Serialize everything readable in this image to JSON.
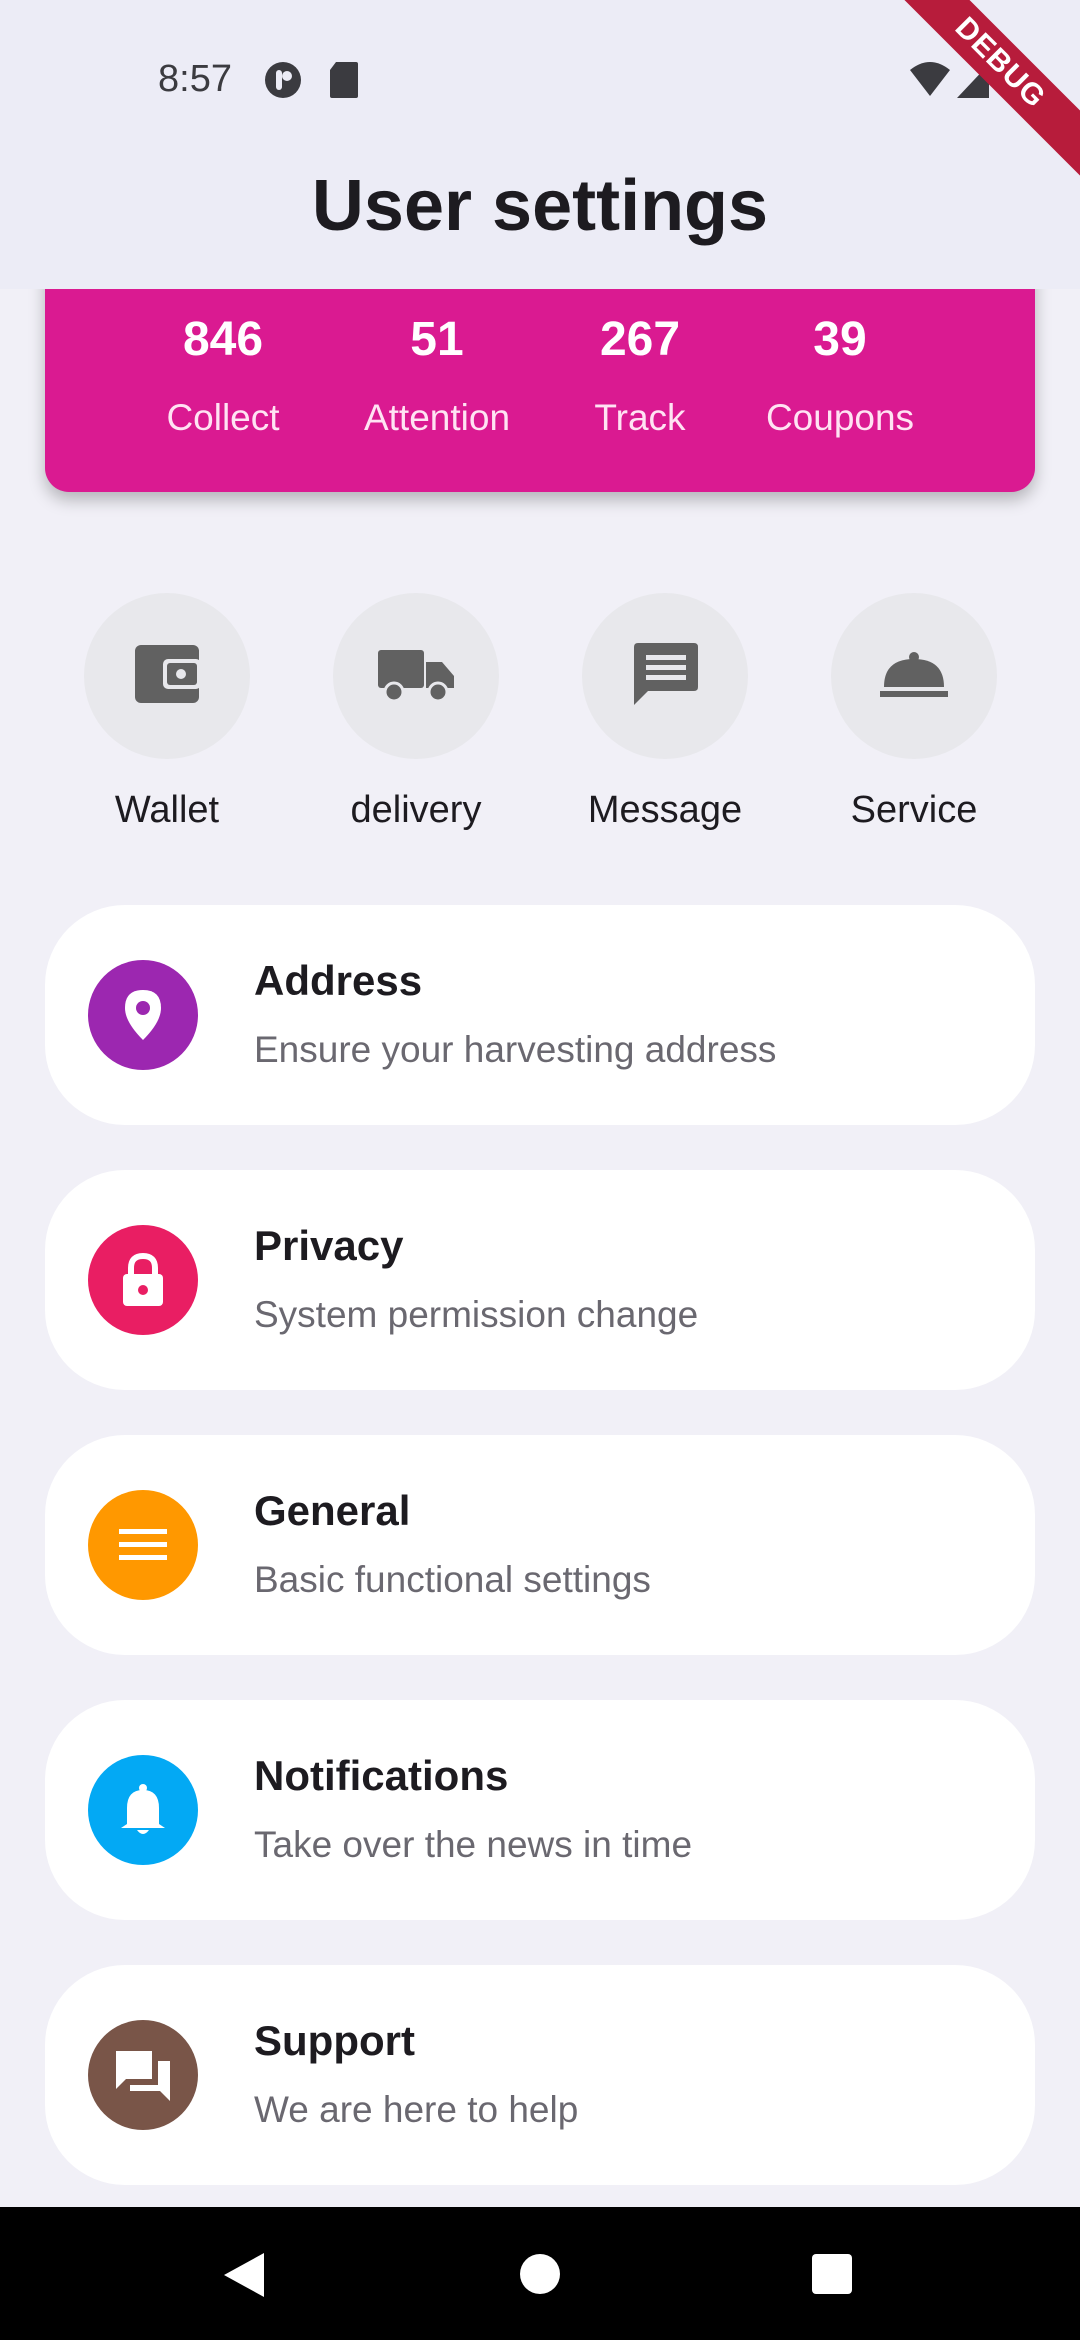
{
  "status_bar": {
    "time": "8:57"
  },
  "debug_banner": "DEBUG",
  "app_bar": {
    "title": "User settings"
  },
  "stats": [
    {
      "value": "846",
      "label": "Collect"
    },
    {
      "value": "51",
      "label": "Attention"
    },
    {
      "value": "267",
      "label": "Track"
    },
    {
      "value": "39",
      "label": "Coupons"
    }
  ],
  "actions": [
    {
      "label": "Wallet",
      "icon": "wallet-icon"
    },
    {
      "label": "delivery",
      "icon": "truck-icon"
    },
    {
      "label": "Message",
      "icon": "message-icon"
    },
    {
      "label": "Service",
      "icon": "room-service-icon"
    }
  ],
  "menu": [
    {
      "title": "Address",
      "subtitle": "Ensure your harvesting address",
      "icon": "location-pin-icon",
      "color": "#9c27b0"
    },
    {
      "title": "Privacy",
      "subtitle": "System permission change",
      "icon": "lock-icon",
      "color": "#e91e63"
    },
    {
      "title": "General",
      "subtitle": "Basic functional settings",
      "icon": "menu-lines-icon",
      "color": "#ff9800"
    },
    {
      "title": "Notifications",
      "subtitle": "Take over the news in time",
      "icon": "bell-icon",
      "color": "#03a9f4"
    },
    {
      "title": "Support",
      "subtitle": "We are here to help",
      "icon": "forum-icon",
      "color": "#795548"
    }
  ],
  "colors": {
    "accent": "#da1a91",
    "background": "#f1f0f7",
    "appbar": "#ececf6"
  }
}
